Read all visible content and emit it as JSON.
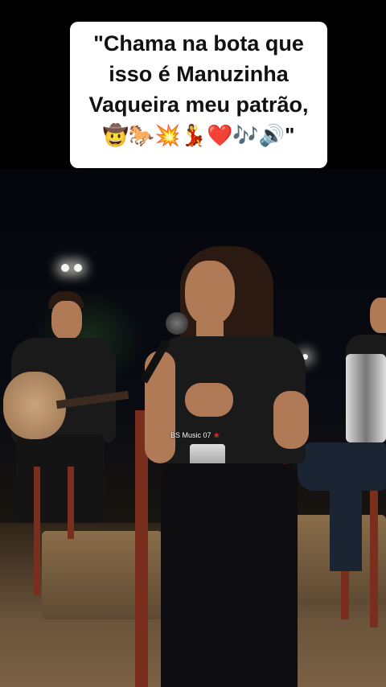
{
  "caption": {
    "lines": [
      "\"Chama na bota que",
      "isso é Manuzinha",
      "Vaqueira meu patrão,"
    ],
    "emoji_line": "🤠🐎💥💃❤️🎶🔊\""
  },
  "video": {
    "watermark": "BS Music 07",
    "watermark_icon": "rose-icon"
  }
}
